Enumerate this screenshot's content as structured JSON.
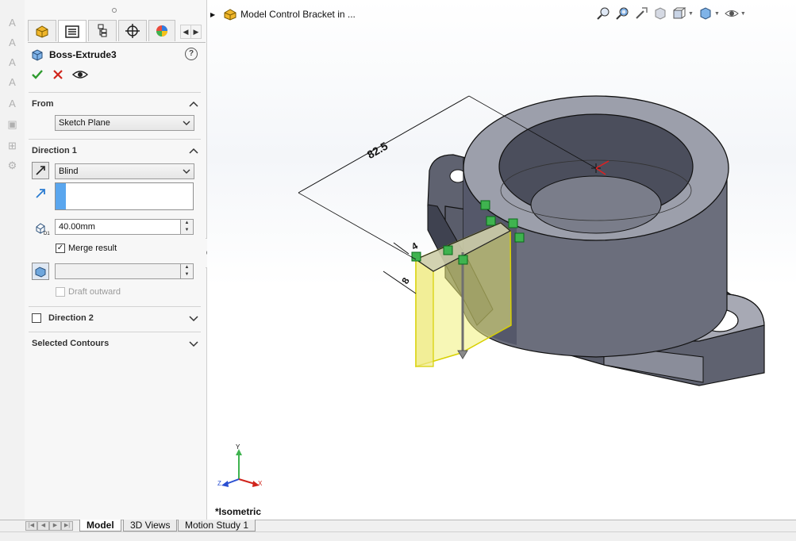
{
  "feature": {
    "title": "Boss-Extrude3",
    "help_icon": "?"
  },
  "from_section": {
    "header": "From",
    "start_condition": "Sketch Plane"
  },
  "direction1": {
    "header": "Direction 1",
    "end_condition": "Blind",
    "depth_value": "40.00mm",
    "merge_result_label": "Merge result",
    "merge_result_checked": true,
    "draft_outward_label": "Draft outward",
    "draft_outward_checked": false,
    "depth_icon_text": "D1"
  },
  "direction2": {
    "header": "Direction 2",
    "checked": false
  },
  "selected_contours": {
    "header": "Selected Contours"
  },
  "document": {
    "name": "Model Control Bracket in ..."
  },
  "viewport": {
    "view_name": "*Isometric",
    "dimension_long": "82.5",
    "dimension_short_a": "4",
    "dimension_short_b": "8",
    "triad_x": "X",
    "triad_y": "Y",
    "triad_z": "Z"
  },
  "bottom_tabs": [
    "Model",
    "3D Views",
    "Motion Study 1"
  ],
  "colors": {
    "accept_green": "#2e9b2e",
    "cancel_red": "#d0241b",
    "selection_blue": "#5aa6ee",
    "preview_yellow": "#f1f07a",
    "part_gray": "#8a8d9a"
  },
  "icons": {
    "panel_tabs": [
      "feature-manager-icon",
      "property-manager-icon",
      "configuration-manager-icon",
      "dimxpert-icon",
      "display-manager-icon"
    ],
    "view_toolbar": [
      "zoom-to-fit-icon",
      "zoom-to-area-icon",
      "previous-view-icon",
      "section-view-icon",
      "view-orientation-icon",
      "display-style-icon",
      "hide-show-items-icon"
    ]
  }
}
